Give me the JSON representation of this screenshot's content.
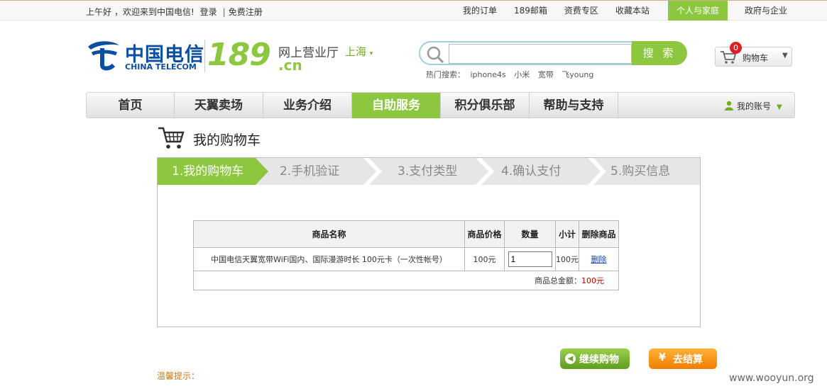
{
  "topbar": {
    "greeting": "上午好",
    "welcome": "，欢迎来到中国电信!",
    "login": "登录",
    "separator": "|",
    "register": "免费注册",
    "links": [
      "我的订单",
      "189邮箱",
      "资费专区",
      "收藏本站",
      "个人与家庭",
      "政府与企业"
    ],
    "active_link": "个人与家庭"
  },
  "logo": {
    "brand_cn": "中国电信",
    "brand_en": "CHINA TELECOM",
    "number": "189",
    "hall": "网上营业厅",
    "city": "上海",
    "domain": ".cn"
  },
  "search": {
    "value": "",
    "button_label": "搜 索",
    "hot_label": "热门搜索：",
    "hot_terms": [
      "iphone4s",
      "小米",
      "宽带",
      "飞young"
    ]
  },
  "cart_widget": {
    "count": "0",
    "label": "购物车"
  },
  "nav": {
    "items": [
      "首页",
      "天翼卖场",
      "业务介绍",
      "自助服务",
      "积分俱乐部",
      "帮助与支持"
    ],
    "active": "自助服务",
    "account_label": "我的账号"
  },
  "page": {
    "title": "我的购物车"
  },
  "steps": [
    "1.我的购物车",
    "2.手机验证",
    "3.支付类型",
    "4.确认支付",
    "5.购买信息"
  ],
  "current_step": 1,
  "table": {
    "headers": [
      "商品名称",
      "商品价格",
      "数量",
      "小计",
      "删除商品"
    ],
    "rows": [
      {
        "name": "中国电信天翼宽带WiFi国内、国际漫游时长 100元卡（一次性帐号）",
        "price": "100元",
        "quantity": "1",
        "subtotal": "100元",
        "delete_label": "删除"
      }
    ],
    "total_label": "商品总金额：",
    "total_value": "100元"
  },
  "actions": {
    "continue_label": "继续购物",
    "checkout_yen": "¥",
    "checkout_label": "去结算"
  },
  "tip_label": "温馨提示：",
  "watermark": "www.wooyun.org",
  "colors": {
    "accent_green": "#8dc63f",
    "brand_blue": "#0b4ea2",
    "checkout_orange": "#f07d00",
    "price_red": "#c00000"
  }
}
